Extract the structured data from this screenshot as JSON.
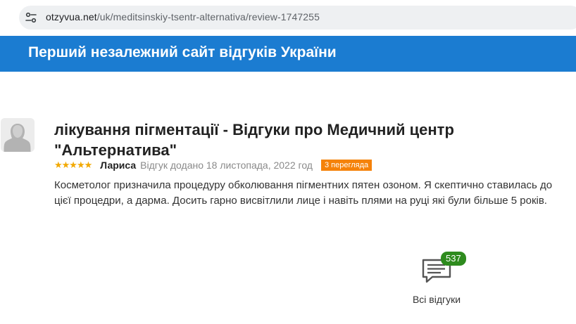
{
  "browser": {
    "url_host": "otzyvua.net",
    "url_path": "/uk/meditsinskiy-tsentr-alternativa/review-1747255",
    "site_info_icon": "tune-icon"
  },
  "header": {
    "tagline": "Перший незалежний сайт відгуків України",
    "background": "#1b7cd1"
  },
  "review": {
    "title": "лікування пігментації - Відгуки про Медичний центр \"Альтернатива\"",
    "rating": 5,
    "stars": "★★★★★",
    "author": "Лариса",
    "date": "Відгук додано 18 листопада, 2022 год",
    "views": "3 перегляда",
    "body": "Косметолог призначила процедуру обколювання пігментних пятен озоном. Я скептично ставилась до цієї процедри, а дарма. Досить гарно висвітлили лице і навіть плями на руці які були більше 5 років.",
    "avatar_icon": "user-avatar-icon"
  },
  "all_reviews": {
    "count": "537",
    "label": "Всі відгуки",
    "icon": "chat-bubble-icon",
    "badge_color": "#2e8b1e"
  }
}
